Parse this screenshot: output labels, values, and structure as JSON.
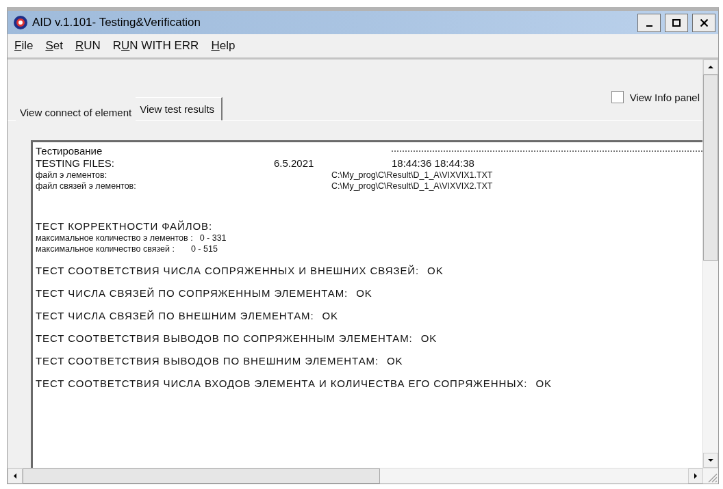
{
  "window": {
    "title": "AID v.1.101-  Testing&Verification"
  },
  "menu": [
    {
      "hotkey": "F",
      "rest": "ile"
    },
    {
      "hotkey": "S",
      "rest": "et"
    },
    {
      "hotkey": "R",
      "rest": "UN"
    },
    {
      "lead": "R",
      "hotkey": "U",
      "rest": "N WITH ERR"
    },
    {
      "hotkey": "H",
      "rest": "elp"
    }
  ],
  "view_info_panel": {
    "label": "View Info panel",
    "checked": false
  },
  "tabs": [
    {
      "label": "View connect of element",
      "selected": false
    },
    {
      "label": "View test results",
      "selected": true
    }
  ],
  "log": [
    {
      "kind": "header",
      "label": "Тестирование"
    },
    {
      "kind": "dated",
      "label": "TESTING FILES:",
      "date": "6.5.2021",
      "time": "18:44:36 18:44:38"
    },
    {
      "kind": "file",
      "label": "файл э лементов:",
      "path": "C:\\My_prog\\C\\Result\\D_1_A\\VIXVIX1.TXT"
    },
    {
      "kind": "file",
      "label": "файл связей э лементов:",
      "path": "C:\\My_prog\\C\\Result\\D_1_A\\VIXVIX2.TXT"
    },
    {
      "kind": "section",
      "label": "ТЕСТ КОРРЕКТНОСТИ ФАЙЛОВ:"
    },
    {
      "kind": "count",
      "label": "максимальное количество э лементов :",
      "value": "0 - 331"
    },
    {
      "kind": "count",
      "label": "максимальное количество связей :",
      "value": "0 - 515"
    },
    {
      "kind": "result",
      "label": "ТЕСТ СООТВЕТСТВИЯ ЧИСЛА СОПРЯЖЕННЫХ И ВНЕШНИХ СВЯЗЕЙ:",
      "status": "OK"
    },
    {
      "kind": "result",
      "label": "ТЕСТ ЧИСЛА СВЯЗЕЙ ПО СОПРЯЖЕННЫМ ЭЛЕМЕНТАМ:",
      "status": "OK"
    },
    {
      "kind": "result",
      "label": "ТЕСТ ЧИСЛА СВЯЗЕЙ ПО ВНЕШНИМ ЭЛЕМЕНТАМ:",
      "status": "OK"
    },
    {
      "kind": "result",
      "label": "ТЕСТ СООТВЕТСТВИЯ ВЫВОДОВ ПО СОПРЯЖЕННЫМ ЭЛЕМЕНТАМ:",
      "status": "OK"
    },
    {
      "kind": "result",
      "label": "ТЕСТ СООТВЕТСТВИЯ ВЫВОДОВ ПО ВНЕШНИМ ЭЛЕМЕНТАМ:",
      "status": "OK"
    },
    {
      "kind": "result",
      "label": "ТЕСТ СООТВЕТСТВИЯ ЧИСЛА ВХОДОВ ЭЛЕМЕНТА И КОЛИЧЕСТВА ЕГО СОПРЯЖЕННЫХ:",
      "status": "OK"
    }
  ]
}
